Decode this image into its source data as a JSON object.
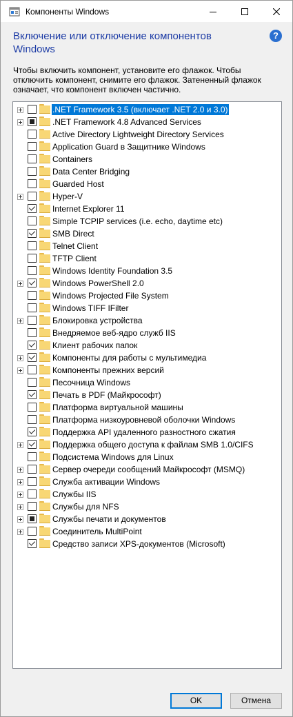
{
  "window": {
    "title": "Компоненты Windows",
    "heading": "Включение или отключение компонентов Windows",
    "description": "Чтобы включить компонент, установите его флажок. Чтобы отключить компонент, снимите его флажок. Затененный флажок означает, что компонент включен частично.",
    "help_glyph": "?"
  },
  "colors": {
    "heading": "#1c3ba5",
    "selection": "#0078d7",
    "folder": "#f8d775"
  },
  "features": [
    {
      "label": ".NET Framework 3.5 (включает .NET 2.0 и 3.0)",
      "expandable": true,
      "state": "unchecked",
      "selected": true
    },
    {
      "label": ".NET Framework 4.8 Advanced Services",
      "expandable": true,
      "state": "partial"
    },
    {
      "label": "Active Directory Lightweight Directory Services",
      "expandable": false,
      "state": "unchecked"
    },
    {
      "label": "Application Guard в Защитнике Windows",
      "expandable": false,
      "state": "unchecked"
    },
    {
      "label": "Containers",
      "expandable": false,
      "state": "unchecked"
    },
    {
      "label": "Data Center Bridging",
      "expandable": false,
      "state": "unchecked"
    },
    {
      "label": "Guarded Host",
      "expandable": false,
      "state": "unchecked"
    },
    {
      "label": "Hyper-V",
      "expandable": true,
      "state": "unchecked"
    },
    {
      "label": "Internet Explorer 11",
      "expandable": false,
      "state": "checked"
    },
    {
      "label": "Simple TCPIP services (i.e. echo, daytime etc)",
      "expandable": false,
      "state": "unchecked"
    },
    {
      "label": "SMB Direct",
      "expandable": false,
      "state": "checked"
    },
    {
      "label": "Telnet Client",
      "expandable": false,
      "state": "unchecked"
    },
    {
      "label": "TFTP Client",
      "expandable": false,
      "state": "unchecked"
    },
    {
      "label": "Windows Identity Foundation 3.5",
      "expandable": false,
      "state": "unchecked"
    },
    {
      "label": "Windows PowerShell 2.0",
      "expandable": true,
      "state": "checked"
    },
    {
      "label": "Windows Projected File System",
      "expandable": false,
      "state": "unchecked"
    },
    {
      "label": "Windows TIFF IFilter",
      "expandable": false,
      "state": "unchecked"
    },
    {
      "label": "Блокировка устройства",
      "expandable": true,
      "state": "unchecked"
    },
    {
      "label": "Внедряемое веб-ядро служб IIS",
      "expandable": false,
      "state": "unchecked"
    },
    {
      "label": "Клиент рабочих папок",
      "expandable": false,
      "state": "checked"
    },
    {
      "label": "Компоненты для работы с мультимедиа",
      "expandable": true,
      "state": "checked"
    },
    {
      "label": "Компоненты прежних версий",
      "expandable": true,
      "state": "unchecked"
    },
    {
      "label": "Песочница Windows",
      "expandable": false,
      "state": "unchecked"
    },
    {
      "label": "Печать в PDF (Майкрософт)",
      "expandable": false,
      "state": "checked"
    },
    {
      "label": "Платформа виртуальной машины",
      "expandable": false,
      "state": "unchecked"
    },
    {
      "label": "Платформа низкоуровневой оболочки Windows",
      "expandable": false,
      "state": "unchecked"
    },
    {
      "label": "Поддержка API удаленного разностного сжатия",
      "expandable": false,
      "state": "checked"
    },
    {
      "label": "Поддержка общего доступа к файлам SMB 1.0/CIFS",
      "expandable": true,
      "state": "checked"
    },
    {
      "label": "Подсистема Windows для Linux",
      "expandable": false,
      "state": "unchecked"
    },
    {
      "label": "Сервер очереди сообщений Майкрософт (MSMQ)",
      "expandable": true,
      "state": "unchecked"
    },
    {
      "label": "Служба активации Windows",
      "expandable": true,
      "state": "unchecked"
    },
    {
      "label": "Службы IIS",
      "expandable": true,
      "state": "unchecked"
    },
    {
      "label": "Службы для NFS",
      "expandable": true,
      "state": "unchecked"
    },
    {
      "label": "Службы печати и документов",
      "expandable": true,
      "state": "partial"
    },
    {
      "label": "Соединитель MultiPoint",
      "expandable": true,
      "state": "unchecked"
    },
    {
      "label": "Средство записи XPS-документов (Microsoft)",
      "expandable": false,
      "state": "checked"
    }
  ],
  "buttons": {
    "ok": "OK",
    "cancel": "Отмена"
  }
}
